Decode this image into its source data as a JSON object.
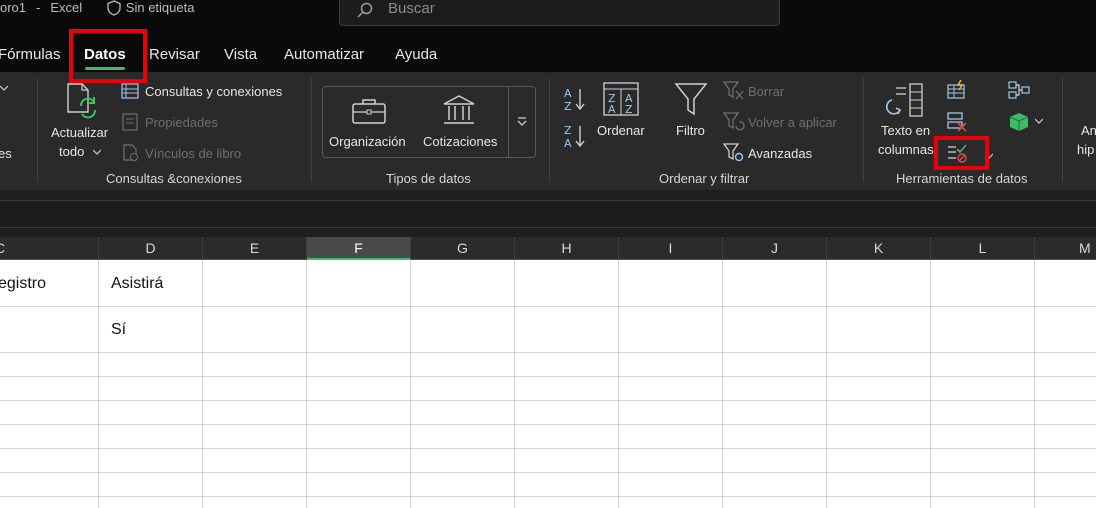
{
  "titlebar": {
    "filename": "oro1",
    "app": "Excel",
    "sensitivity": "Sin etiqueta",
    "search_placeholder": "Buscar"
  },
  "tabs": [
    "Fórmulas",
    "Datos",
    "Revisar",
    "Vista",
    "Automatizar",
    "Ayuda"
  ],
  "active_tab": "Datos",
  "ribbon": {
    "left_partial": "es",
    "refresh": {
      "line1": "Actualizar",
      "line2": "todo"
    },
    "queries": {
      "items": [
        "Consultas y conexiones",
        "Propiedades",
        "Vínculos de libro"
      ],
      "group_label": "Consultas &conexiones"
    },
    "data_types": {
      "items": [
        "Organización",
        "Cotizaciones"
      ],
      "group_label": "Tipos de datos"
    },
    "sort_filter": {
      "sort": "Ordenar",
      "filter": "Filtro",
      "clear": "Borrar",
      "reapply": "Volver a aplicar",
      "advanced": "Avanzadas",
      "group_label": "Ordenar y filtrar"
    },
    "data_tools": {
      "text_to_columns": {
        "line1": "Texto en",
        "line2": "columnas"
      },
      "group_label": "Herramientas de datos"
    },
    "right_partial": {
      "line1": "An",
      "line2": "hip"
    }
  },
  "columns": [
    "C",
    "D",
    "E",
    "F",
    "G",
    "H",
    "I",
    "J",
    "K",
    "L",
    "M"
  ],
  "selected_column": "F",
  "cells": {
    "c1": "egistro",
    "d1": "Asistirá",
    "d2": "Sí"
  },
  "colors": {
    "accent": "#3dbb6a",
    "highlight": "#e8000b",
    "ribbon_bg": "#2a2a2a"
  }
}
